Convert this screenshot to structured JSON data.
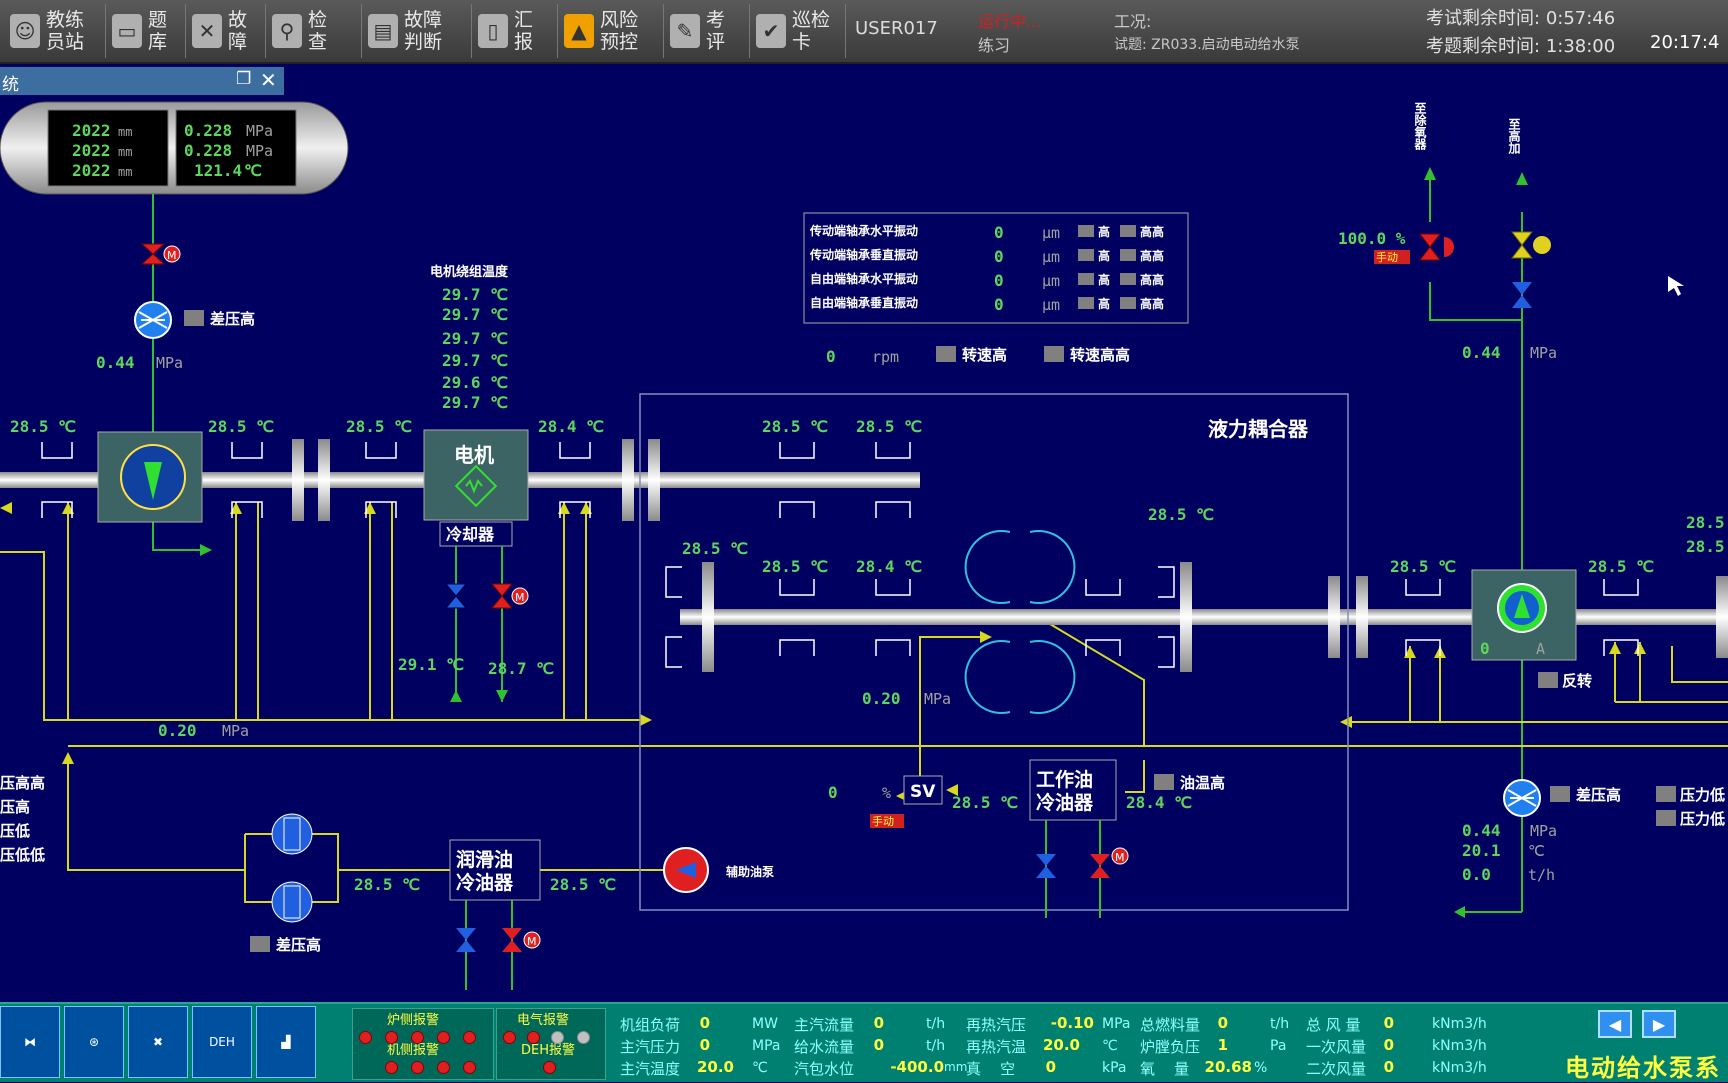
{
  "toolbar": {
    "buttons": [
      {
        "label": "教练\n员站",
        "icon": "coach-icon"
      },
      {
        "label": "题\n库",
        "icon": "folder-icon"
      },
      {
        "label": "故\n障",
        "icon": "fault-icon"
      },
      {
        "label": "检\n查",
        "icon": "magnifier-icon"
      },
      {
        "label": "故障\n判断",
        "icon": "monitor-icon"
      },
      {
        "label": "汇\n报",
        "icon": "clipboard-icon"
      },
      {
        "label": "风险\n预控",
        "icon": "warning-icon"
      },
      {
        "label": "考\n评",
        "icon": "evaluation-icon"
      },
      {
        "label": "巡检\n卡",
        "icon": "inspection-card-icon"
      }
    ],
    "user": "USER017",
    "status": "运行中...",
    "mode": "练习",
    "condition_label": "工况:",
    "task": "试题: ZR033.启动电动给水泵",
    "exam_time_label": "考试剩余时间:",
    "exam_time": "0:57:46",
    "question_time_label": "考题剩余时间:",
    "question_time": "1:38:00",
    "clock": "20:17:4"
  },
  "window": {
    "title": "统",
    "restore_icon": "restore-icon",
    "close_icon": "close-icon"
  },
  "diagram": {
    "tank": {
      "levels": [
        "2022",
        "2022",
        "2022"
      ],
      "level_unit": "mm",
      "pressures": [
        "0.228",
        "0.228"
      ],
      "pressure_unit": "MPa",
      "temp": "121.4",
      "temp_unit": "℃"
    },
    "inlet_filter_alarm": "差压高",
    "inlet_pressure": "0.44",
    "pressure_unit": "MPa",
    "temp_unit": "℃",
    "winding_title": "电机绕组温度",
    "winding_temps": [
      "29.7 ℃",
      "29.7 ℃",
      "29.7 ℃",
      "29.7 ℃",
      "29.6 ℃",
      "29.7 ℃"
    ],
    "vibration": [
      {
        "label": "传动端轴承水平振动",
        "value": "0",
        "unit": "μm",
        "a1": "高",
        "a2": "高高"
      },
      {
        "label": "传动端轴承垂直振动",
        "value": "0",
        "unit": "μm",
        "a1": "高",
        "a2": "高高"
      },
      {
        "label": "自由端轴承水平振动",
        "value": "0",
        "unit": "μm",
        "a1": "高",
        "a2": "高高"
      },
      {
        "label": "自由端轴承垂直振动",
        "value": "0",
        "unit": "μm",
        "a1": "高",
        "a2": "高高"
      }
    ],
    "speed": "0",
    "speed_unit": "rpm",
    "speed_alarm_high": "转速高",
    "speed_alarm_highhigh": "转速高高",
    "motor_label": "电机",
    "cooler_label": "冷却器",
    "coupling_label": "液力耦合器",
    "bearing_temps_top": [
      "28.5 ℃",
      "28.5 ℃",
      "28.5 ℃",
      "28.4 ℃",
      "28.5 ℃",
      "28.5 ℃"
    ],
    "bearing_temps_mid": [
      "28.5 ℃",
      "28.5 ℃",
      "28.4 ℃",
      "28.5 ℃",
      "28.5 ℃",
      "28.5 ℃"
    ],
    "coupling_right_temp": "28.5 ℃",
    "right_edge_temps": [
      "28.5",
      "28.5"
    ],
    "cooler_water_in": "29.1 ℃",
    "cooler_water_out": "28.7 ℃",
    "lube_pressure": "0.20",
    "work_oil_pressure": "0.20",
    "sv_value": "0",
    "sv_unit": "%",
    "sv_label": "SV",
    "manual_tag": "手动",
    "work_oil_cooler_label": "工作油\n冷油器",
    "work_oil_in": "28.5 ℃",
    "work_oil_out": "28.4 ℃",
    "oil_temp_alarm": "油温高",
    "lube_cooler_label": "润滑油\n冷油器",
    "lube_in": "28.5 ℃",
    "lube_out": "28.5 ℃",
    "aux_pump_label": "辅助油泵",
    "lube_filter_alarm": "差压高",
    "left_alarms": [
      "压高高",
      "压高",
      "压低",
      "压低低"
    ],
    "to_deaerator": "至除氧器",
    "to_hp_heater": "至高加",
    "recirc_valve_pct": "100.0 %",
    "discharge_pressure": "0.44",
    "pump_current": "0",
    "pump_current_unit": "A",
    "reverse_alarm": "反转",
    "outlet_filter_alarm": "差压高",
    "pressure_low": "压力低",
    "pressure_lowlow": "压力低",
    "outlet_pressure": "0.44",
    "outlet_temp": "20.1",
    "outlet_flow": "0.0",
    "flow_unit": "t/h"
  },
  "bottom": {
    "icons": [
      "valve-icon",
      "transformer-icon",
      "fan-icon",
      "deh-icon",
      "trend-chart-icon"
    ],
    "deh_label": "DEH",
    "alarms": {
      "boiler": "炉侧报警",
      "turbine": "机侧报警",
      "electric": "电气报警",
      "deh": "DEH报警"
    },
    "params": [
      {
        "label": "机组负荷",
        "value": "0",
        "unit": "MW"
      },
      {
        "label": "主汽压力",
        "value": "0",
        "unit": "MPa"
      },
      {
        "label": "主汽温度",
        "value": "20.0",
        "unit": "℃"
      },
      {
        "label": "主汽流量",
        "value": "0",
        "unit": "t/h"
      },
      {
        "label": "给水流量",
        "value": "0",
        "unit": "t/h"
      },
      {
        "label": "汽包水位",
        "value": "-400.0",
        "unit": "mm"
      },
      {
        "label": "再热汽压",
        "value": "-0.10",
        "unit": "MPa"
      },
      {
        "label": "再热汽温",
        "value": "20.0",
        "unit": "℃"
      },
      {
        "label": "真    空",
        "value": "0",
        "unit": "kPa"
      },
      {
        "label": "总燃料量",
        "value": "0",
        "unit": "t/h"
      },
      {
        "label": "炉膛负压",
        "value": "1",
        "unit": "Pa"
      },
      {
        "label": "氧    量",
        "value": "20.68",
        "unit": "%"
      },
      {
        "label": "总 风 量",
        "value": "0",
        "unit": "kNm3/h"
      },
      {
        "label": "一次风量",
        "value": "0",
        "unit": "kNm3/h"
      },
      {
        "label": "二次风量",
        "value": "0",
        "unit": "kNm3/h"
      }
    ],
    "system_name": "电动给水泵系",
    "nav_prev": "◀",
    "nav_next": "▶"
  }
}
